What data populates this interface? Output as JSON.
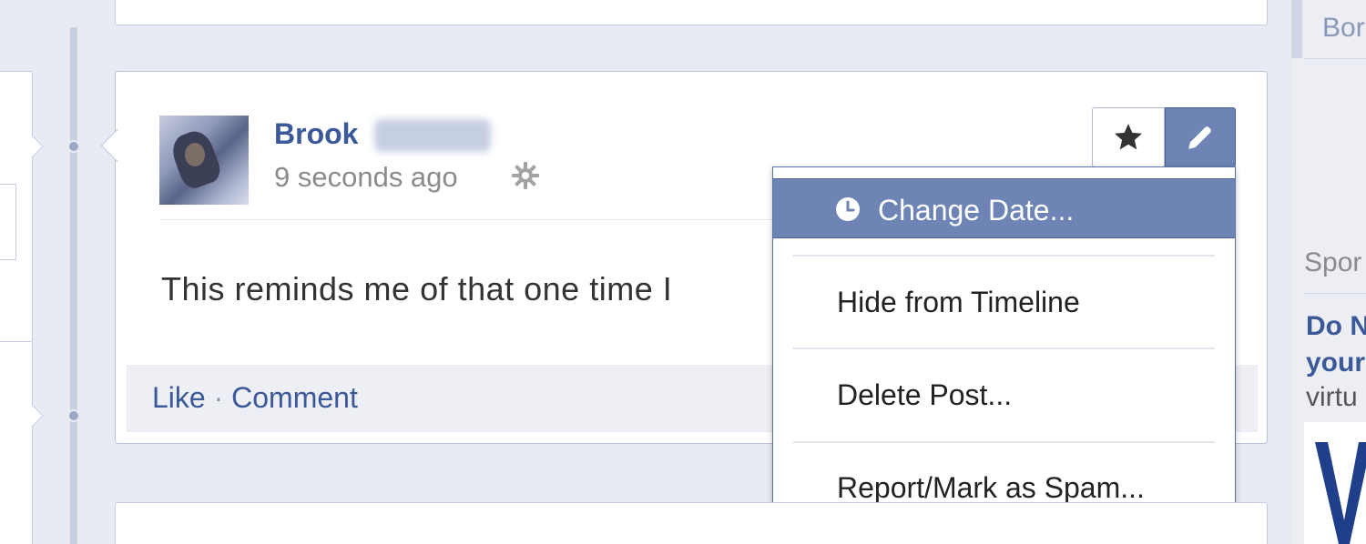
{
  "post": {
    "author_first": "Brook",
    "timestamp": "9 seconds ago",
    "text": "This reminds me of that one time I",
    "actions": {
      "like": "Like",
      "separator": "·",
      "comment": "Comment"
    }
  },
  "controls": {
    "star_icon": "star-icon",
    "edit_icon": "pencil-icon"
  },
  "menu": {
    "items": [
      {
        "label": "Change Date...",
        "icon": "clock-icon",
        "active": true
      },
      {
        "label": "Hide from Timeline",
        "active": false
      },
      {
        "label": "Delete Post...",
        "active": false
      },
      {
        "label": "Report/Mark as Spam...",
        "active": false
      }
    ]
  },
  "right_column": {
    "top_text": "Bor",
    "section_heading": "Spor",
    "ad_title_line1": "Do N",
    "ad_title_line2": "your",
    "ad_body": "virtu"
  },
  "colors": {
    "brand_blue": "#3b5998",
    "menu_highlight": "#6d84b4",
    "page_bg": "#e9ebf2"
  }
}
